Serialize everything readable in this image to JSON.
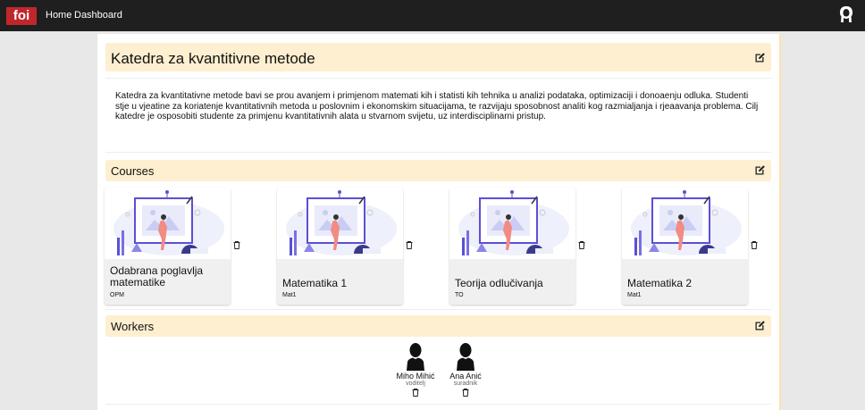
{
  "nav": {
    "logo": "foi",
    "home": "Home",
    "dashboard": "Dashboard"
  },
  "department": {
    "title": "Katedra za kvantitivne metode",
    "description": "Katedra za kvantitativne metode bavi se prou avanjem i primjenom matemati kih i statisti kih tehnika u analizi podataka, optimizaciji i donoaenju odluka. Studenti stje u vjeatine za koriatenje kvantitativnih metoda u poslovnim i ekonomskim situacijama, te razvijaju sposobnost analiti kog razmialjanja i rjeaavanja problema. Cilj katedre je osposobiti studente za primjenu kvantitativnih alata u stvarnom svijetu, uz interdisciplinarni pristup."
  },
  "courses_section": {
    "title": "Courses",
    "items": [
      {
        "title": "Odabrana poglavlja matematike",
        "code": "OPM"
      },
      {
        "title": "Matematika 1",
        "code": "Mat1"
      },
      {
        "title": "Teorija odlučivanja",
        "code": "TO"
      },
      {
        "title": "Matematika 2",
        "code": "Mat1"
      }
    ]
  },
  "workers_section": {
    "title": "Workers",
    "items": [
      {
        "name": "Miho Mihić",
        "role": "voditelj"
      },
      {
        "name": "Ana Anić",
        "role": "suradnik"
      }
    ]
  },
  "colors": {
    "topbar": "#1f1f1f",
    "logo_bg": "#c0272d",
    "section_header": "#fdefd0",
    "illustration_accent": "#5b4fd6"
  },
  "icons": {
    "edit": "edit-square-icon",
    "delete": "trash-icon",
    "user": "user-silhouette-icon"
  }
}
